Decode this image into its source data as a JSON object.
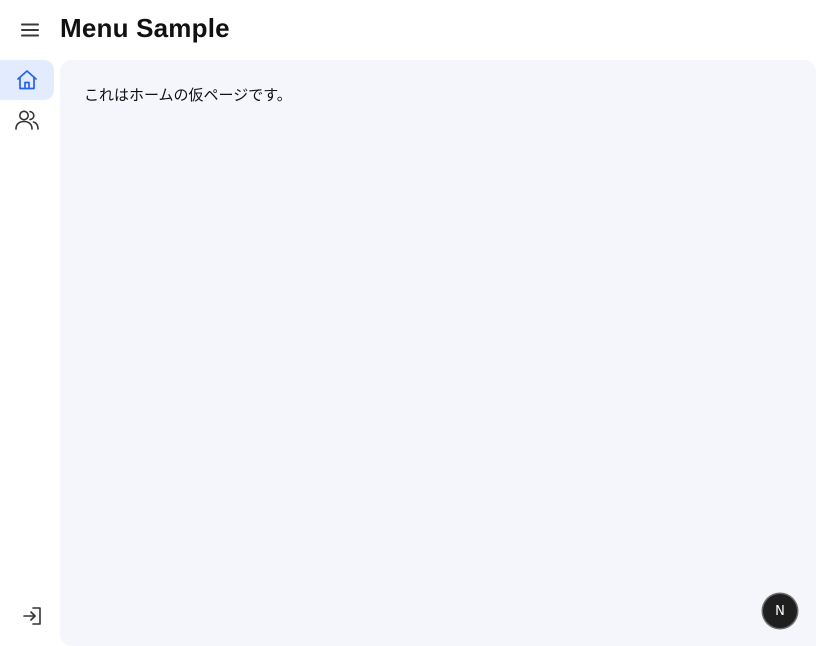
{
  "header": {
    "menu_icon": "hamburger-menu-icon",
    "title": "Menu Sample"
  },
  "sidebar": {
    "items": [
      {
        "name": "home",
        "icon": "home-icon",
        "active": true
      },
      {
        "name": "users",
        "icon": "users-icon",
        "active": false
      }
    ],
    "footer_item": {
      "name": "logout",
      "icon": "sign-in-icon"
    }
  },
  "main": {
    "text": "これはホームの仮ページです。"
  },
  "badge": {
    "letter": "N"
  },
  "colors": {
    "accent": "#2563eb",
    "active_bg": "#e3ebff",
    "content_bg": "#f4f6fb",
    "icon": "#333333"
  }
}
